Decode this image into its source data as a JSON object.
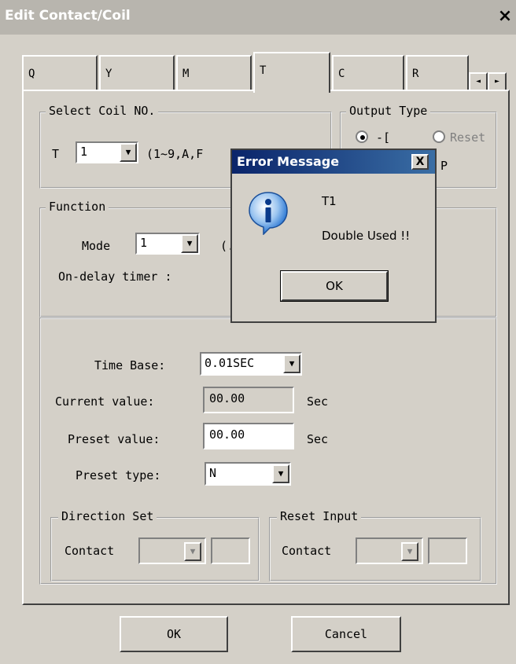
{
  "window": {
    "title": "Edit Contact/Coil",
    "close": "×"
  },
  "tabs": [
    {
      "label": "Q"
    },
    {
      "label": "Y"
    },
    {
      "label": "M"
    },
    {
      "label": "T"
    },
    {
      "label": "C"
    },
    {
      "label": "R"
    }
  ],
  "tab_scroll": {
    "left": "◄",
    "right": "►"
  },
  "select_coil": {
    "legend": "Select Coil NO.",
    "prefix": "T",
    "value": "1",
    "range_hint": "(1~9,A,F"
  },
  "output_type": {
    "legend": "Output Type",
    "option_set": "-[",
    "option_reset": "Reset",
    "option_extra": "P"
  },
  "function": {
    "legend": "Function",
    "mode_label": "Mode",
    "mode_value": "1",
    "mode_hint": "(.",
    "description": "On-delay timer :"
  },
  "timer": {
    "time_base_label": "Time Base:",
    "time_base_value": "0.01SEC",
    "current_label": "Current value:",
    "current_value": "00.00",
    "current_unit": "Sec",
    "preset_label": "Preset value:",
    "preset_value": "00.00",
    "preset_unit": "Sec",
    "preset_type_label": "Preset type:",
    "preset_type_value": "N"
  },
  "direction_set": {
    "legend": "Direction Set",
    "contact_label": "Contact"
  },
  "reset_input": {
    "legend": "Reset Input",
    "contact_label": "Contact"
  },
  "buttons": {
    "ok": "OK",
    "cancel": "Cancel"
  },
  "error_dialog": {
    "title": "Error Message",
    "close": "X",
    "line1": "T1",
    "line2": "Double Used !!",
    "ok": "OK",
    "icon": "info-icon"
  },
  "colors": {
    "title_active": "#0a246a",
    "title_inactive": "#b8b5ae",
    "face": "#d4d0c8",
    "info_blue": "#1f6fd0"
  }
}
